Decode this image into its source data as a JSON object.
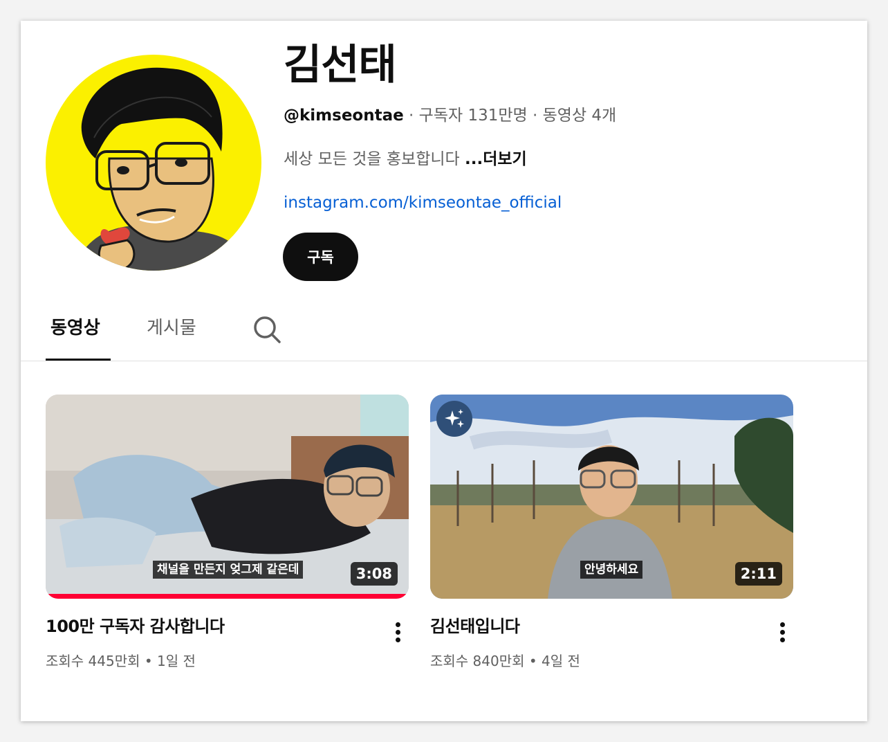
{
  "channel": {
    "title": "김선태",
    "handle": "@kimseontae",
    "subscribers": "구독자 131만명",
    "video_count": "동영상 4개",
    "separator": " · ",
    "description": "세상 모든 것을 홍보합니다",
    "more_label": "...더보기",
    "link": "instagram.com/kimseontae_official",
    "subscribe_label": "구독",
    "avatar_bg": "#fbf000"
  },
  "tabs": [
    {
      "label": "동영상",
      "selected": true
    },
    {
      "label": "게시물",
      "selected": false
    }
  ],
  "search_icon": "search-icon",
  "videos": [
    {
      "title": "100만 구독자 감사합니다",
      "views": "조회수 445만회",
      "age": "1일 전",
      "separator": " • ",
      "duration": "3:08",
      "caption": "채널을 만든지 엊그제 같은데",
      "watched_fraction": 1.0,
      "progress_color": "#ff0033"
    },
    {
      "title": "김선태입니다",
      "views": "조회수 840만회",
      "age": "4일 전",
      "separator": " • ",
      "duration": "2:11",
      "caption": "안녕하세요",
      "badge_icon": "sparkle-icon"
    }
  ],
  "colors": {
    "text_primary": "#0f0f0f",
    "text_secondary": "#606060",
    "link": "#065fd4",
    "button_bg": "#0f0f0f"
  }
}
